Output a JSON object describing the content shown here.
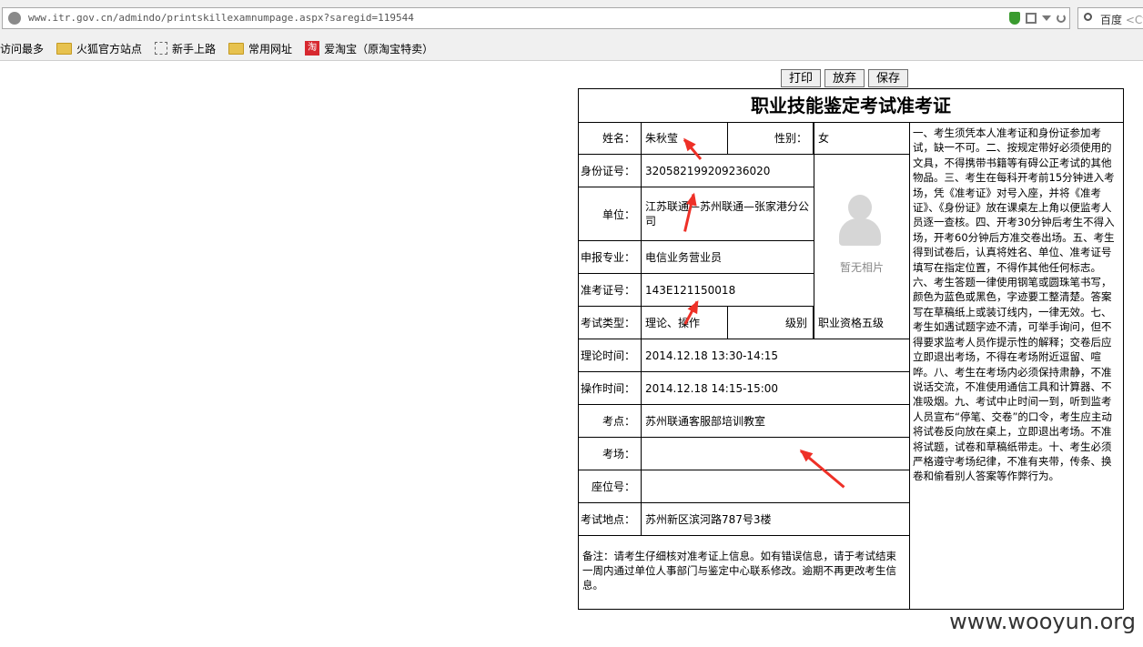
{
  "browser": {
    "url": "www.itr.gov.cn/admindo/printskillexamnumpage.aspx?saregid=119544",
    "search_engine": "百度",
    "search_hint": "<Ct",
    "bookmarks": [
      "访问最多",
      "火狐官方站点",
      "新手上路",
      "常用网址",
      "爱淘宝（原淘宝特卖）"
    ]
  },
  "toolbar": {
    "print": "打印",
    "discard": "放弃",
    "save": "保存"
  },
  "card": {
    "title": "职业技能鉴定考试准考证",
    "name_label": "姓名：",
    "name": "朱秋莹",
    "gender_label": "性别：",
    "gender": "女",
    "id_label": "身份证号：",
    "id": "320582199209236020",
    "unit_label": "单位：",
    "unit": "江苏联通—苏州联通—张家港分公司",
    "major_label": "申报专业：",
    "major": "电信业务营业员",
    "ticket_label": "准考证号：",
    "ticket": "143E121150018",
    "type_label": "考试类型：",
    "type": "理论、操作",
    "level_label": "级别",
    "level": "职业资格五级",
    "theory_label": "理论时间：",
    "theory_time": "2014.12.18 13:30-14:15",
    "practice_label": "操作时间：",
    "practice_time": "2014.12.18 14:15-15:00",
    "site_label": "考点：",
    "site": "苏州联通客服部培训教室",
    "room_label": "考场：",
    "room": "",
    "seat_label": "座位号：",
    "seat": "",
    "address_label": "考试地点：",
    "address": "苏州新区滨河路787号3楼",
    "note": "备注：请考生仔细核对准考证上信息。如有错误信息，请于考试结束一周内通过单位人事部门与鉴定中心联系修改。逾期不再更改考生信息。",
    "photo_text": "暂无相片",
    "rules": "一、考生须凭本人准考证和身份证参加考试，缺一不可。二、按规定带好必须使用的文具，不得携带书籍等有碍公正考试的其他物品。三、考生在每科开考前15分钟进入考场，凭《准考证》对号入座，并将《准考证》、《身份证》放在课桌左上角以便监考人员逐一查核。四、开考30分钟后考生不得入场，开考60分钟后方准交卷出场。五、考生得到试卷后，认真将姓名、单位、准考证号填写在指定位置，不得作其他任何标志。六、考生答题一律使用钢笔或圆珠笔书写，颜色为蓝色或黑色，字迹要工整清楚。答案写在草稿纸上或装订线内，一律无效。七、考生如遇试题字迹不清，可举手询问，但不得要求监考人员作提示性的解释；交卷后应立即退出考场，不得在考场附近逗留、喧哗。八、考生在考场内必须保持肃静，不准说话交流，不准使用通信工具和计算器、不准吸烟。九、考试中止时间一到，听到监考人员宣布“停笔、交卷”的口令，考生应主动将试卷反向放在桌上，立即退出考场。不准将试题，试卷和草稿纸带走。十、考生必须严格遵守考场纪律，不准有夹带，传条、换卷和偷看别人答案等作弊行为。"
  },
  "watermark": "www.wooyun.org",
  "colors": {
    "annotation": "#ee3027",
    "shield": "#3a9b2f"
  }
}
